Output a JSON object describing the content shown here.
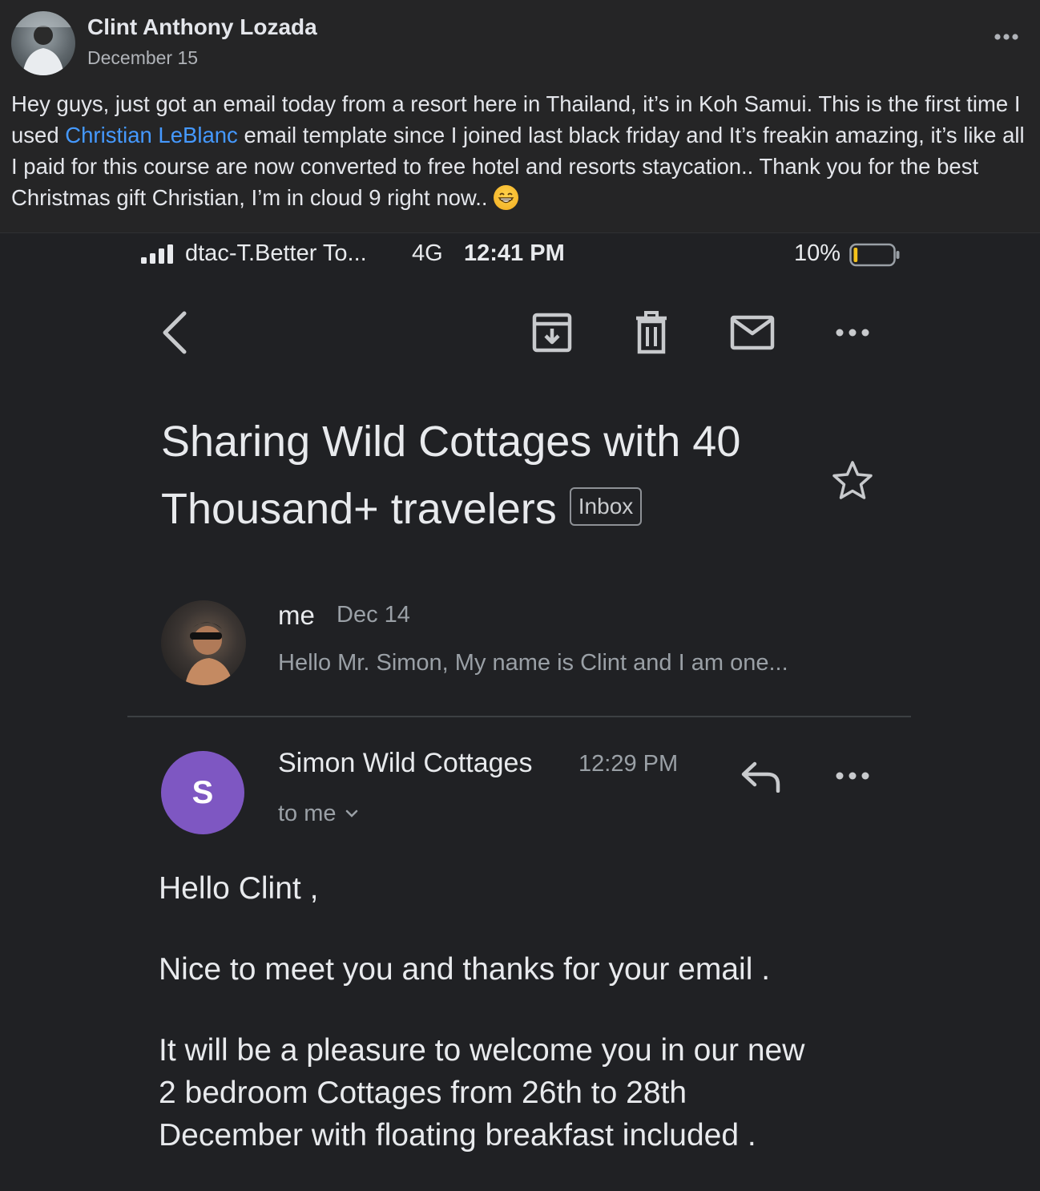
{
  "post": {
    "author": "Clint Anthony Lozada",
    "date": "December 15",
    "text_before_link": "Hey guys, just got an email today from a resort here in Thailand, it’s in Koh Samui. This is the first time I used ",
    "link_text": "Christian LeBlanc",
    "text_after_link": " email template since I joined last black friday and It’s freakin amazing, it’s like all I paid for this course are now converted to free hotel and resorts staycation.. Thank you for the best Christmas gift Christian, I’m in cloud 9 right now.. ",
    "emoji": "grinning-face-emoji"
  },
  "status_bar": {
    "carrier": "dtac-T.Better To...",
    "network": "4G",
    "time": "12:41 PM",
    "battery_percent": "10%",
    "battery_level": 0.1,
    "battery_color": "#f4c21b"
  },
  "toolbar": {
    "icons": [
      "back-arrow-icon",
      "archive-icon",
      "delete-icon",
      "mark-unread-icon",
      "more-icon"
    ]
  },
  "email": {
    "subject": "Sharing Wild Cottages with 40 Thousand+ travelers",
    "label": "Inbox",
    "message1": {
      "from": "me",
      "date": "Dec 14",
      "snippet": "Hello Mr. Simon, My name is Clint and I am one..."
    },
    "message2": {
      "avatar_letter": "S",
      "avatar_color": "#7e57c2",
      "from": "Simon Wild Cottages",
      "time": "12:29 PM",
      "to": "to me",
      "body": [
        "Hello Clint ,",
        "Nice to meet you and thanks for your email .",
        "It will be a pleasure to welcome you in our new",
        "2 bedroom Cottages from 26th to 28th",
        "December with floating breakfast included ."
      ]
    }
  }
}
